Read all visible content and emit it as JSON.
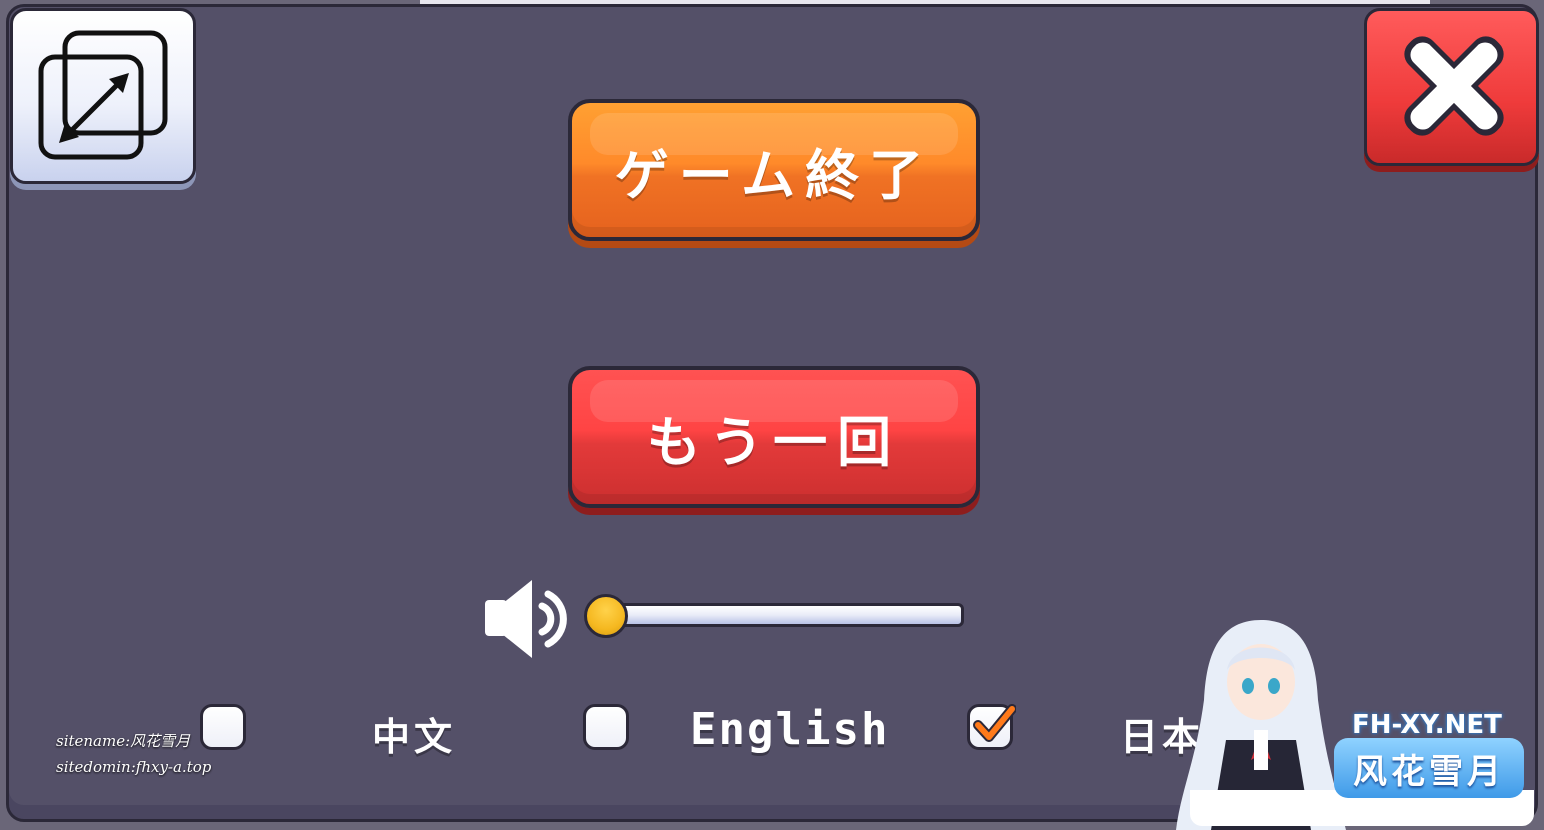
{
  "buttons": {
    "quit_label": "ゲーム終了",
    "retry_label": "もう一回"
  },
  "volume": {
    "level": 0.0
  },
  "languages": [
    {
      "label": "中文",
      "checked": false
    },
    {
      "label": "English",
      "checked": false
    },
    {
      "label": "日本語",
      "checked": true
    }
  ],
  "watermark": {
    "sitename": "sitename:风花雪月",
    "sitedomain": "sitedomin:fhxy-a.top",
    "domain": "FH-XY.NET",
    "logo": "风花雪月"
  },
  "icons": {
    "resize": "resize-window-icon",
    "close": "close-x-icon",
    "speaker": "speaker-volume-icon",
    "check": "checkmark-icon"
  },
  "colors": {
    "panel": "#545068",
    "quit_button": "#ff8a2a",
    "retry_button": "#ff4444",
    "close_button": "#ef3b3b",
    "slider_knob": "#f5b820",
    "checkmark": "#ff7a1a"
  }
}
